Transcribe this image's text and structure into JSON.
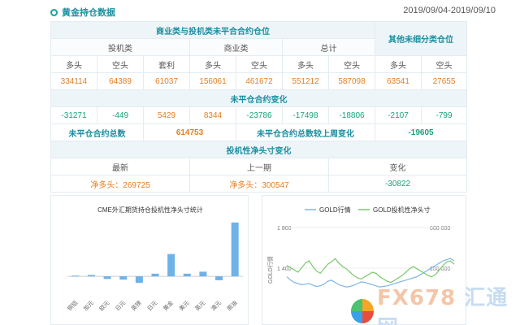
{
  "header": {
    "title": "黄金持仓数据",
    "date_range": "2019/09/04-2019/09/10"
  },
  "table": {
    "main_header": "商业类与投机类未平合合约仓位",
    "other_header": "其他未细分类仓位",
    "groups": [
      "投机类",
      "商业类",
      "总计"
    ],
    "col_labels": [
      "多头",
      "空头",
      "套利",
      "多头",
      "空头",
      "多头",
      "空头",
      "多头",
      "空头"
    ],
    "values": [
      "334114",
      "64389",
      "61037",
      "156061",
      "461672",
      "551212",
      "587098",
      "63541",
      "27655"
    ],
    "change_header": "未平仓合约变化",
    "changes": [
      "-31271",
      "-449",
      "5429",
      "8344",
      "-23786",
      "-17498",
      "-18806",
      "-2107",
      "-799"
    ],
    "total_label": "未平仓合约总数",
    "total_value": "614753",
    "weekly_label": "未平仓合约总数较上周变化",
    "weekly_value": "-19605",
    "spec_header": "投机性净头寸变化",
    "spec_cols": [
      "最新",
      "上一期",
      "变化"
    ],
    "spec_values": [
      "净多头：269725",
      "净多头：300547",
      "-30822"
    ]
  },
  "left_chart": {
    "title": "CME外汇期货持仓投机性净头寸统计"
  },
  "right_chart": {
    "legend": [
      "GOLD行情",
      "GOLD投机性净头寸"
    ],
    "y_left_ticks": [
      "1 800",
      "1 400"
    ],
    "y_right_ticks": [
      "600 000",
      "200 000"
    ],
    "y_left_label": "GOLD行情"
  },
  "chart_data": [
    {
      "type": "bar",
      "title": "CME外汇期货持仓投机性净头寸统计",
      "categories": [
        "铜铝",
        "加元",
        "欧元",
        "日元",
        "英镑",
        "日元",
        "黄金",
        "美元",
        "英元",
        "澳元",
        "原油"
      ],
      "values": [
        0.5,
        1,
        -2,
        -2.5,
        -5,
        2,
        17,
        2,
        3.5,
        -3,
        41
      ],
      "ylim": [
        -8,
        44
      ],
      "grid": false
    },
    {
      "type": "line",
      "series": [
        {
          "name": "GOLD行情",
          "axis": "left",
          "values": [
            1360,
            1330,
            1310,
            1300,
            1290,
            1295,
            1300,
            1285,
            1275,
            1280,
            1295,
            1320,
            1330,
            1310,
            1290,
            1280,
            1270,
            1275,
            1285,
            1300,
            1315,
            1310,
            1300,
            1290,
            1280,
            1270,
            1275,
            1280,
            1290,
            1300,
            1310,
            1320,
            1330,
            1340,
            1350,
            1360,
            1380,
            1400,
            1420,
            1440,
            1460,
            1480,
            1500,
            1510,
            1520,
            1500
          ]
        },
        {
          "name": "GOLD投机性净头寸",
          "axis": "right",
          "values": [
            260000,
            240000,
            220000,
            200000,
            240000,
            280000,
            300000,
            250000,
            210000,
            190000,
            230000,
            270000,
            290000,
            320000,
            280000,
            250000,
            230000,
            200000,
            170000,
            150000,
            140000,
            160000,
            180000,
            200000,
            190000,
            160000,
            140000,
            120000,
            110000,
            130000,
            150000,
            170000,
            200000,
            230000,
            250000,
            230000,
            210000,
            190000,
            170000,
            160000,
            180000,
            220000,
            260000,
            290000,
            300000,
            270000
          ]
        }
      ],
      "ylim_left": [
        1200,
        1800
      ],
      "ylim_right": [
        0,
        600000
      ],
      "legend_position": "top"
    }
  ],
  "watermark": {
    "text_a": "FX678",
    "text_b": "汇通网"
  },
  "colors": {
    "accent": "#1a8fa0",
    "positive": "#e67e22",
    "negative": "#1aa07a",
    "bar": "#6fb2e8",
    "gold_line": "#7fb6e6",
    "net_line": "#79c96b"
  }
}
